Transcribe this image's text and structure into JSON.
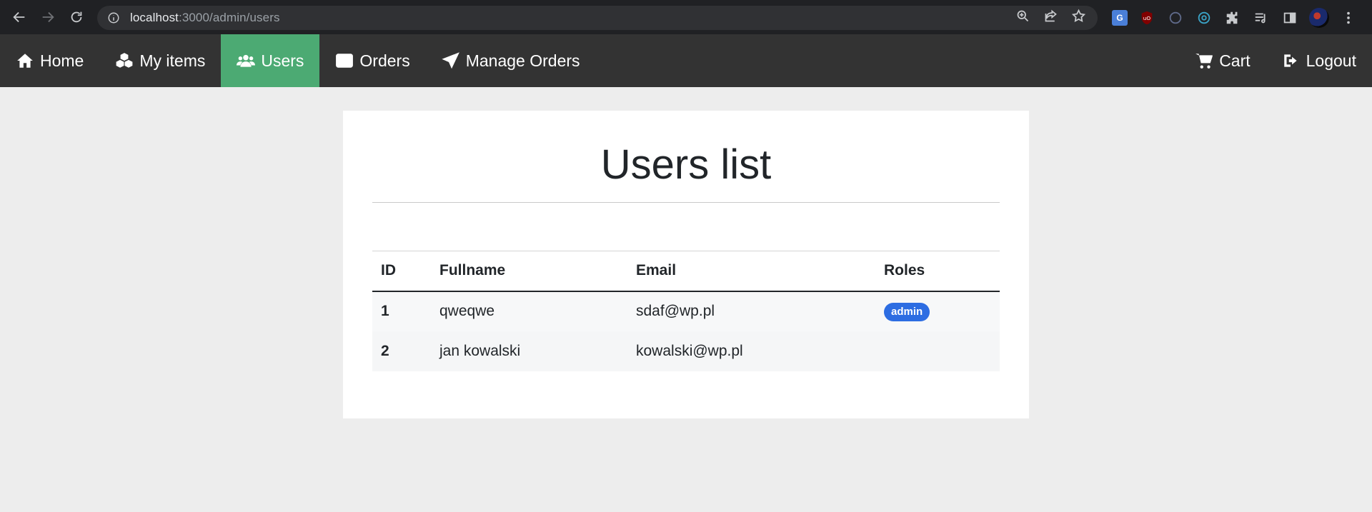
{
  "browser": {
    "url_host": "localhost",
    "url_path": ":3000/admin/users",
    "icons": [
      "back-icon",
      "forward-icon",
      "reload-icon",
      "info-icon",
      "zoom-icon",
      "share-icon",
      "star-icon",
      "translate-extension-icon",
      "ublock-icon",
      "extension-circle-icon",
      "extension-at-icon",
      "puzzle-icon",
      "reading-list-icon",
      "side-panel-icon",
      "profile-avatar",
      "more-icon"
    ],
    "translate_label": "G",
    "ublock_label": "uO"
  },
  "nav": {
    "items": [
      {
        "label": "Home",
        "icon": "home-icon"
      },
      {
        "label": "My items",
        "icon": "cubes-icon"
      },
      {
        "label": "Users",
        "icon": "users-icon",
        "active": true
      },
      {
        "label": "Orders",
        "icon": "credit-card-icon"
      },
      {
        "label": "Manage Orders",
        "icon": "paper-plane-icon"
      }
    ],
    "right": [
      {
        "label": "Cart",
        "icon": "cart-icon"
      },
      {
        "label": "Logout",
        "icon": "logout-icon"
      }
    ],
    "active_color": "#4caa73",
    "bar_color": "#333333"
  },
  "main": {
    "title": "Users list",
    "table": {
      "headers": [
        "ID",
        "Fullname",
        "Email",
        "Roles"
      ],
      "rows": [
        {
          "id": "1",
          "fullname": "qweqwe",
          "email": "sdaf@wp.pl",
          "roles": [
            "admin"
          ]
        },
        {
          "id": "2",
          "fullname": "jan kowalski",
          "email": "kowalski@wp.pl",
          "roles": []
        }
      ]
    },
    "badge_color": "#2d6de2"
  }
}
